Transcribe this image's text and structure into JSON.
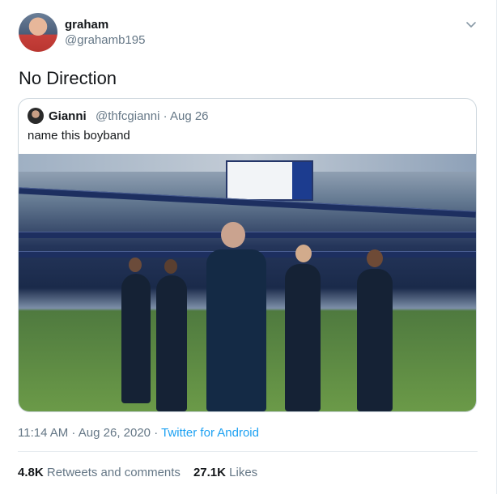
{
  "user": {
    "display_name": "graham",
    "handle": "@grahamb195"
  },
  "tweet": {
    "text": "No Direction",
    "time": "11:14 AM",
    "sep1": " · ",
    "date": "Aug 26, 2020",
    "sep2": " · ",
    "source": "Twitter for Android"
  },
  "quoted": {
    "display_name": "Gianni",
    "handle": "@thfcgianni",
    "separator": " · ",
    "date": "Aug 26",
    "text": "name this boyband"
  },
  "stats": {
    "retweets_count": "4.8K",
    "retweets_label": "Retweets and comments",
    "likes_count": "27.1K",
    "likes_label": "Likes"
  },
  "icons": {
    "menu": "chevron-down-icon"
  },
  "colors": {
    "link": "#1da1f2",
    "muted": "#657786",
    "text": "#14171a"
  }
}
